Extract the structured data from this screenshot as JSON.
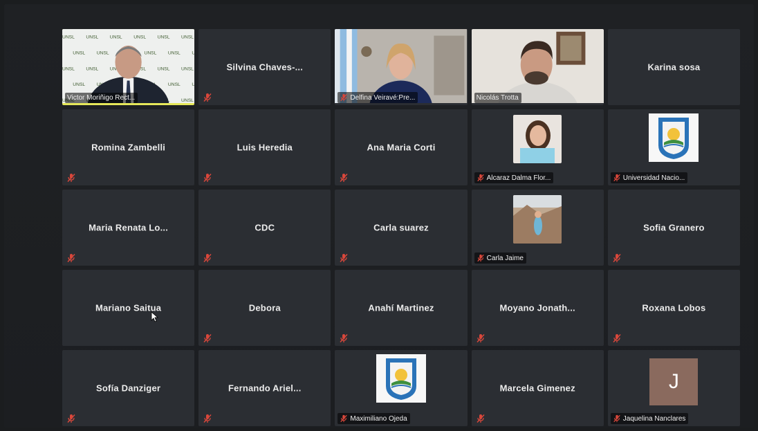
{
  "participants": [
    {
      "name": "Victor Moriñigo Rect...",
      "type": "video-host",
      "muted": false,
      "active": true
    },
    {
      "name": "Silvina  Chaves-...",
      "type": "name",
      "muted": true
    },
    {
      "name": "Delfina Veiravé:Pre...",
      "type": "video-delfina",
      "muted": true
    },
    {
      "name": "Nicolás Trotta",
      "type": "video-nicolas",
      "muted": false
    },
    {
      "name": "Karina sosa",
      "type": "name",
      "muted": false
    },
    {
      "name": "Romina Zambelli",
      "type": "name",
      "muted": true
    },
    {
      "name": "Luis Heredia",
      "type": "name",
      "muted": true
    },
    {
      "name": "Ana Maria Corti",
      "type": "name",
      "muted": true
    },
    {
      "name": "Alcaraz Dalma Flor...",
      "type": "photo-girl",
      "muted": true
    },
    {
      "name": "Universidad Nacio...",
      "type": "logo",
      "muted": true
    },
    {
      "name": "Maria Renata Lo...",
      "type": "name",
      "muted": true
    },
    {
      "name": "CDC",
      "type": "name",
      "muted": true
    },
    {
      "name": "Carla suarez",
      "type": "name",
      "muted": true
    },
    {
      "name": "Carla Jaime",
      "type": "photo-landscape",
      "muted": true
    },
    {
      "name": "Sofia Granero",
      "type": "name",
      "muted": true
    },
    {
      "name": "Mariano Saitua",
      "type": "name",
      "muted": false
    },
    {
      "name": "Debora",
      "type": "name",
      "muted": true
    },
    {
      "name": "Anahí Martinez",
      "type": "name",
      "muted": true
    },
    {
      "name": "Moyano  Jonath...",
      "type": "name",
      "muted": true
    },
    {
      "name": "Roxana Lobos",
      "type": "name",
      "muted": true
    },
    {
      "name": "Sofía Danziger",
      "type": "name",
      "muted": true
    },
    {
      "name": "Fernando  Ariel...",
      "type": "name",
      "muted": true
    },
    {
      "name": "Maximiliano Ojeda",
      "type": "logo",
      "muted": true
    },
    {
      "name": "Marcela Gimenez",
      "type": "name",
      "muted": true
    },
    {
      "name": "Jaquelina Nanclares",
      "type": "avatar",
      "avatar_letter": "J",
      "muted": true
    }
  ],
  "colors": {
    "tile_bg": "#2b2e33",
    "active_outline": "#e6e85a",
    "mute_red": "#d9473b"
  },
  "icons": {
    "mute": "microphone-muted-icon",
    "cursor": "mouse-cursor-icon"
  }
}
